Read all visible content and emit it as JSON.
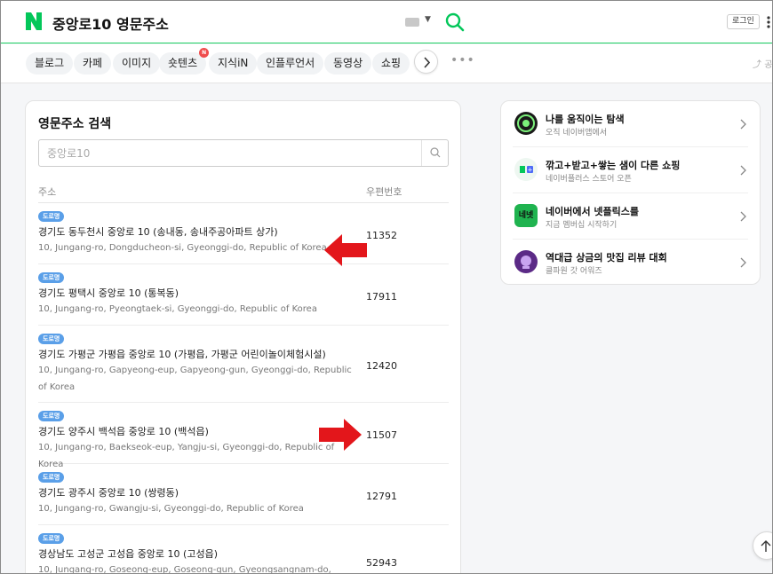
{
  "header": {
    "query": "중앙로10 영문주소",
    "login_label": "로그인",
    "logo_letter": "N",
    "brand_color": "#03c75a"
  },
  "tabs": [
    {
      "label": "블로그"
    },
    {
      "label": "카페"
    },
    {
      "label": "이미지"
    },
    {
      "label": "숏텐츠",
      "badge": "N"
    },
    {
      "label": "지식iN"
    },
    {
      "label": "인플루언서"
    },
    {
      "label": "동영상"
    },
    {
      "label": "쇼핑"
    }
  ],
  "share_label": "공",
  "address_card": {
    "title": "영문주소 검색",
    "search_placeholder": "중앙로10",
    "col_address": "주소",
    "col_zip": "우편번호",
    "rows": [
      {
        "badge": "도로명",
        "kor": "경기도 동두천시 중앙로 10 (송내동, 송내주공아파트 상가)",
        "eng": "10, Jungang-ro, Dongducheon-si, Gyeonggi-do, Republic of Korea",
        "zip": "11352"
      },
      {
        "badge": "도로명",
        "kor": "경기도 평택시 중앙로 10 (통복동)",
        "eng": "10, Jungang-ro, Pyeongtaek-si, Gyeonggi-do, Republic of Korea",
        "zip": "17911"
      },
      {
        "badge": "도로명",
        "kor": "경기도 가평군 가평읍 중앙로 10 (가평읍, 가평군 어린이놀이체험시설)",
        "eng": "10, Jungang-ro, Gapyeong-eup, Gapyeong-gun, Gyeonggi-do, Republic of Korea",
        "zip": "12420"
      },
      {
        "badge": "도로명",
        "kor": "경기도 양주시 백석읍 중앙로 10 (백석읍)",
        "eng": "10, Jungang-ro, Baekseok-eup, Yangju-si, Gyeonggi-do, Republic of Korea",
        "zip": "11507"
      },
      {
        "badge": "도로명",
        "kor": "경기도 광주시 중앙로 10 (쌍령동)",
        "eng": "10, Jungang-ro, Gwangju-si, Gyeonggi-do, Republic of Korea",
        "zip": "12791"
      },
      {
        "badge": "도로명",
        "kor": "경상남도 고성군 고성읍 중앙로 10 (고성읍)",
        "eng": "10, Jungang-ro, Goseong-eup, Goseong-gun, Gyeongsangnam-do,",
        "zip": "52943"
      }
    ]
  },
  "promos": [
    {
      "title": "나를 움직이는 탐색",
      "sub": "오직 네이버앱에서",
      "icon_color": "#1a1a1a"
    },
    {
      "title": "깎고+받고+쌓는 샘이 다른 쇼핑",
      "sub": "네이버플러스 스토어 오픈",
      "icon_color": "#eef7f1"
    },
    {
      "title": "네이버에서 넷플릭스를",
      "sub": "지금 멤버십 시작하기",
      "icon_color": "#1fb34f",
      "icon_text": "네넷"
    },
    {
      "title": "역대급 상금의 맛집 리뷰 대회",
      "sub": "클파원 갓 어워즈",
      "icon_color": "#5b2a86"
    }
  ],
  "accent_red": "#e3161b"
}
